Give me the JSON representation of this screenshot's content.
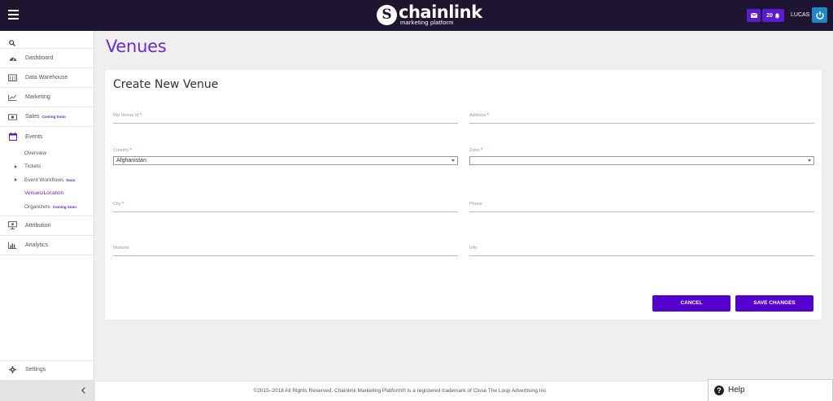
{
  "app": {
    "logo_name": "chainlink",
    "logo_tagline": "marketing platform",
    "logo_mark": "S"
  },
  "topbar": {
    "mail_icon": "envelope-icon",
    "notifications_count": "20",
    "notifications_icon": "bell-icon",
    "user_name": "LUCAS",
    "power_icon": "power-icon",
    "accent_color": "#5b1bd4"
  },
  "sidebar": {
    "search_icon": "search-icon",
    "items": [
      {
        "label": "Dashboard",
        "icon": "tachometer-icon"
      },
      {
        "label": "Data Warehouse",
        "icon": "warehouse-icon"
      },
      {
        "label": "Marketing",
        "icon": "line-chart-icon"
      },
      {
        "label": "Sales",
        "icon": "money-icon",
        "badge": "Coming Soon"
      },
      {
        "label": "Events",
        "icon": "calendar-icon"
      }
    ],
    "events_sub": [
      {
        "label": "Overview"
      },
      {
        "label": "Tickets"
      },
      {
        "label": "Event Workflows",
        "badge": "Soon"
      },
      {
        "label": "Venues/Location"
      },
      {
        "label": "Organizers",
        "badge": "Coming Soon"
      }
    ],
    "items_after": [
      {
        "label": "Attribution",
        "icon": "presentation-icon"
      },
      {
        "label": "Analytics",
        "icon": "bar-chart-icon"
      }
    ],
    "settings_label": "Settings",
    "collapse_icon": "chevron-left-icon"
  },
  "page": {
    "title": "Venues",
    "card_title": "Create New Venue"
  },
  "form": {
    "wp_venue_id_label": "Wp Venue Id",
    "address_label": "Address",
    "country_label": "Country",
    "country_value": "Afghanistan",
    "zone_label": "Zone",
    "zone_value": "",
    "city_label": "City",
    "phone_label": "Phone",
    "website_label": "Website",
    "info_label": "Info",
    "required_mark": "*"
  },
  "buttons": {
    "cancel": "CANCEL",
    "save": "SAVE CHANGES"
  },
  "footer": {
    "text": "©2015–2018 All Rights Reserved. Chainlink Marketing Platform® is a registered trademark of Close The Loop Advertising Inc"
  },
  "help": {
    "label": "Help",
    "icon": "question-circle-icon"
  }
}
